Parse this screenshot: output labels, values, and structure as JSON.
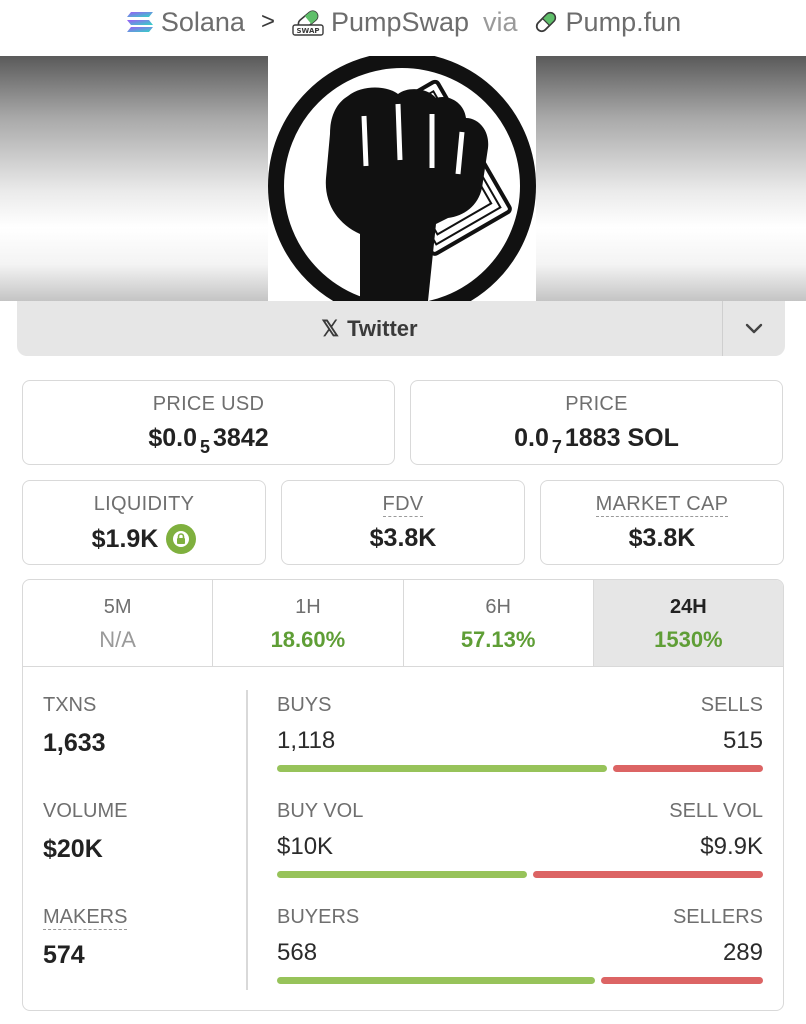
{
  "breadcrumb": {
    "chain": "Solana",
    "separator": ">",
    "dex": "PumpSwap",
    "via": "via",
    "launchpad": "Pump.fun",
    "swap_badge": "SWAP"
  },
  "links": {
    "twitter_label": "Twitter",
    "twitter_glyph": "𝕏"
  },
  "price": {
    "usd_label": "PRICE USD",
    "usd_prefix": "$0.0",
    "usd_zeros": "5",
    "usd_digits": "3842",
    "native_label": "PRICE",
    "native_prefix": "0.0",
    "native_zeros": "7",
    "native_digits": "1883 SOL"
  },
  "stats": {
    "liquidity_label": "LIQUIDITY",
    "liquidity_value": "$1.9K",
    "fdv_label": "FDV",
    "fdv_value": "$3.8K",
    "mcap_label": "MARKET CAP",
    "mcap_value": "$3.8K"
  },
  "tabs": [
    {
      "label": "5M",
      "value": "N/A"
    },
    {
      "label": "1H",
      "value": "18.60%"
    },
    {
      "label": "6H",
      "value": "57.13%"
    },
    {
      "label": "24H",
      "value": "1530%"
    }
  ],
  "active_tab": "24H",
  "metrics": {
    "txns_label": "TXNS",
    "txns_value": "1,633",
    "volume_label": "VOLUME",
    "volume_value": "$20K",
    "makers_label": "MAKERS",
    "makers_value": "574",
    "buys_label": "BUYS",
    "buys_value": "1,118",
    "sells_label": "SELLS",
    "sells_value": "515",
    "buy_vol_label": "BUY VOL",
    "buy_vol_value": "$10K",
    "sell_vol_label": "SELL VOL",
    "sell_vol_value": "$9.9K",
    "buyers_label": "BUYERS",
    "buyers_value": "568",
    "sellers_label": "SELLERS",
    "sellers_value": "289",
    "buy_share_txns": 0.685,
    "buy_share_volume": 0.52,
    "buy_share_makers": 0.66
  },
  "colors": {
    "positive": "#5f9e36",
    "buy_bar": "#97c35a",
    "sell_bar": "#dc6464",
    "lock_badge": "#7fb03e"
  }
}
